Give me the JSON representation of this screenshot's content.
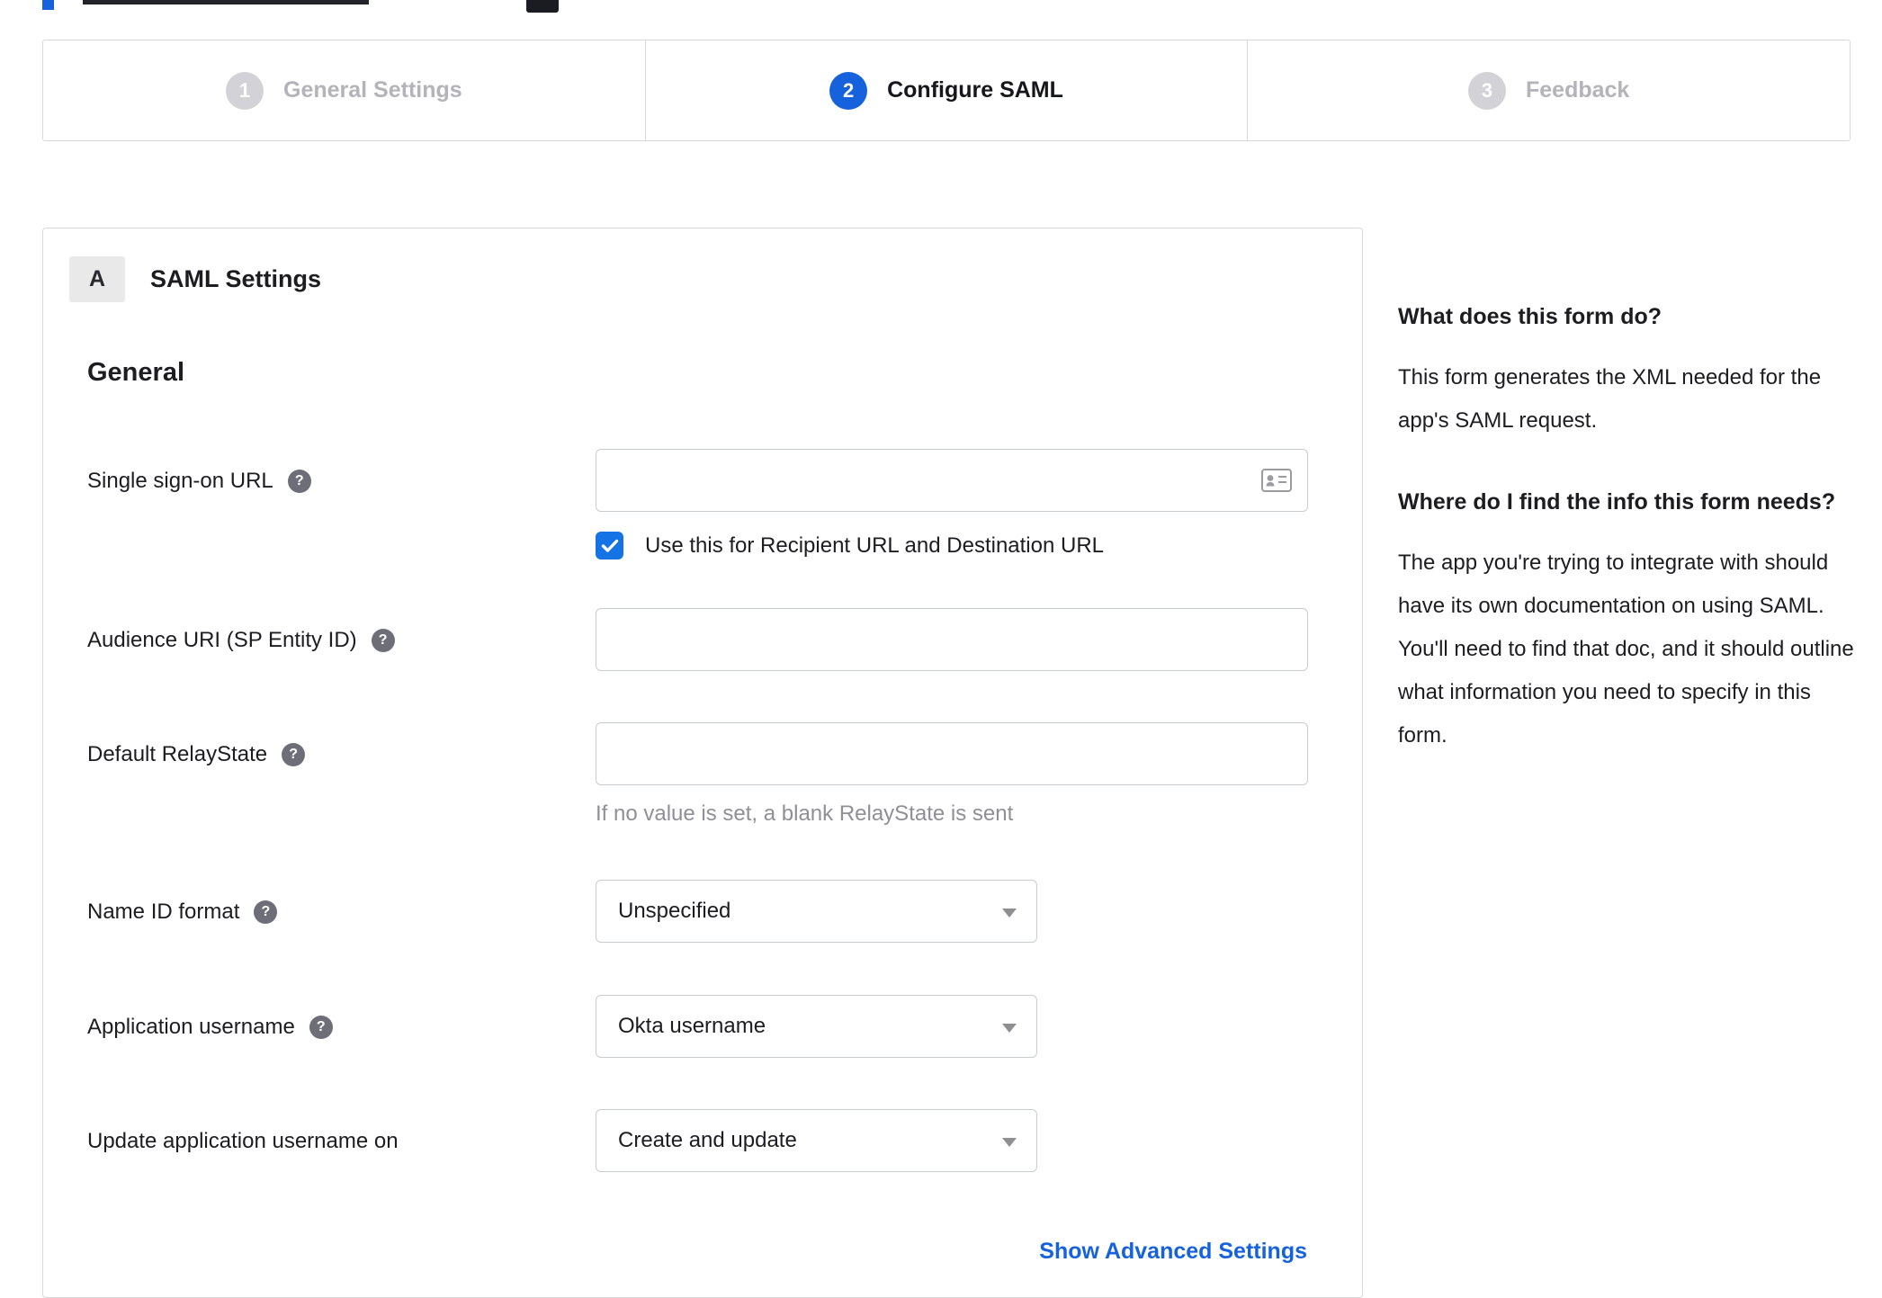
{
  "colors": {
    "accent_blue": "#1662dd",
    "checkbox_blue": "#1673e6",
    "inactive_gray": "#d3d3d7"
  },
  "icons": {
    "help": "?"
  },
  "stepper": {
    "steps": [
      {
        "number": "1",
        "label": "General Settings",
        "state": "inactive"
      },
      {
        "number": "2",
        "label": "Configure SAML",
        "state": "active"
      },
      {
        "number": "3",
        "label": "Feedback",
        "state": "inactive"
      }
    ]
  },
  "panel": {
    "badge": "A",
    "title": "SAML Settings",
    "section": "General",
    "sso": {
      "label": "Single sign-on URL",
      "value": "",
      "checkbox_checked": true,
      "checkbox_label": "Use this for Recipient URL and Destination URL"
    },
    "audience": {
      "label": "Audience URI (SP Entity ID)",
      "value": ""
    },
    "relay": {
      "label": "Default RelayState",
      "value": "",
      "hint": "If no value is set, a blank RelayState is sent"
    },
    "name_id": {
      "label": "Name ID format",
      "value": "Unspecified"
    },
    "app_username": {
      "label": "Application username",
      "value": "Okta username"
    },
    "update_username": {
      "label": "Update application username on",
      "value": "Create and update"
    },
    "advanced_link": "Show Advanced Settings"
  },
  "sidebar": {
    "q1": "What does this form do?",
    "a1": "This form generates the XML needed for the app's SAML request.",
    "q2": "Where do I find the info this form needs?",
    "a2": "The app you're trying to integrate with should have its own documentation on using SAML. You'll need to find that doc, and it should outline what information you need to specify in this form."
  }
}
